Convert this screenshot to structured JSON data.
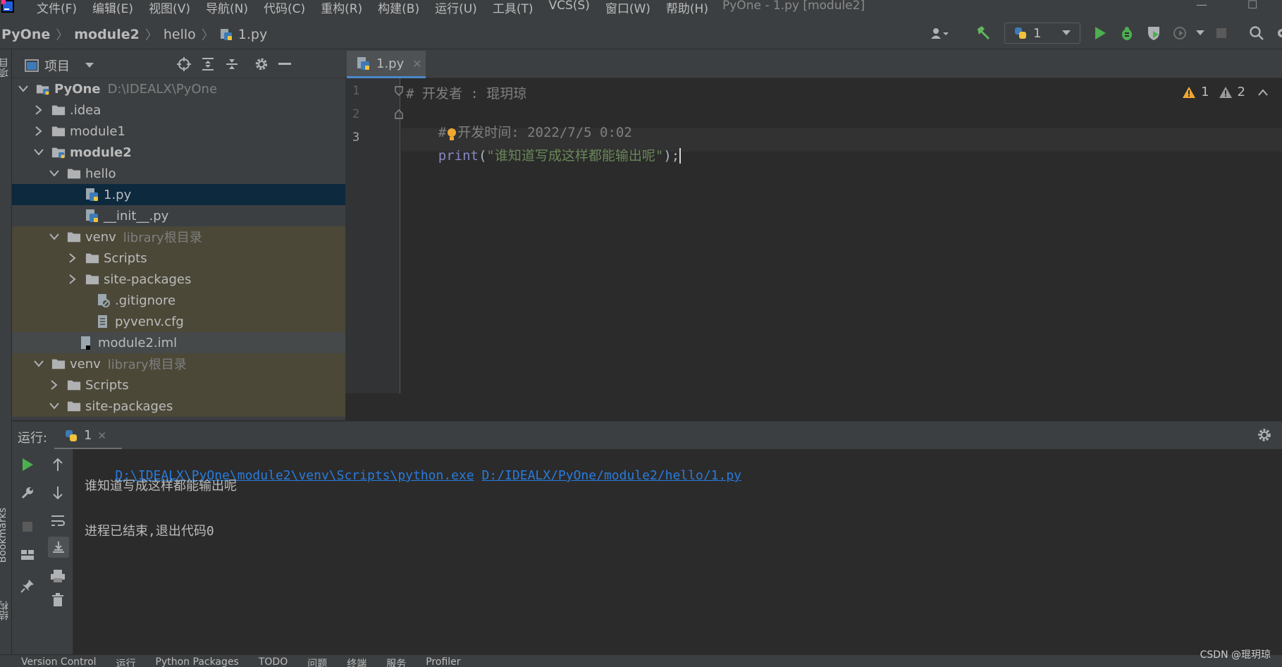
{
  "menubar": {
    "items": [
      "文件(F)",
      "编辑(E)",
      "视图(V)",
      "导航(N)",
      "代码(C)",
      "重构(R)",
      "构建(B)",
      "运行(U)",
      "工具(T)",
      "VCS(S)",
      "窗口(W)",
      "帮助(H)"
    ],
    "window_title": "PyOne - 1.py [module2]"
  },
  "navbar": {
    "crumbs": [
      "PyOne",
      "module2",
      "hello",
      "1.py"
    ],
    "run_config_label": "1"
  },
  "left_strip": {
    "top_label": "项目",
    "bookmarks_label": "Bookmarks",
    "structure_label": "结构"
  },
  "project_panel": {
    "title": "项目",
    "tree": [
      {
        "name": "PyOne",
        "hint": "D:\\IDEALX\\PyOne"
      },
      {
        "name": ".idea"
      },
      {
        "name": "module1"
      },
      {
        "name": "module2"
      },
      {
        "name": "hello"
      },
      {
        "name": "1.py"
      },
      {
        "name": "__init__.py"
      },
      {
        "name": "venv",
        "hint": "library根目录"
      },
      {
        "name": "Scripts"
      },
      {
        "name": "site-packages"
      },
      {
        "name": ".gitignore"
      },
      {
        "name": "pyvenv.cfg"
      },
      {
        "name": "module2.iml"
      },
      {
        "name": "venv",
        "hint": "library根目录"
      },
      {
        "name": "Scripts"
      },
      {
        "name": "site-packages"
      }
    ]
  },
  "editor": {
    "tab_label": "1.py",
    "line_numbers": [
      "1",
      "2",
      "3"
    ],
    "lines": {
      "l1": "# 开发者 : 琨玥琼",
      "l2a": "#",
      "l2b": "开发时间: 2022/7/5 0:02",
      "l3_kw": "print",
      "l3_open": "(",
      "l3_str": "\"谁知道写成这样都能输出呢\"",
      "l3_close": ");"
    },
    "inspections": {
      "warnings": "1",
      "weak_warnings": "2"
    }
  },
  "run_panel": {
    "label": "运行:",
    "tab_label": "1",
    "console": {
      "exe_path": "D:\\IDEALX\\PyOne\\module2\\venv\\Scripts\\python.exe",
      "script_path": "D:/IDEALX/PyOne/module2/hello/1.py",
      "output": "谁知道写成这样都能输出呢",
      "exit_msg": "进程已结束,退出代码0"
    }
  },
  "statusbar": {
    "items": [
      "Version Control",
      "运行",
      "Python Packages",
      "TODO",
      "问题",
      "终端",
      "服务",
      "Profiler"
    ]
  },
  "watermark": "CSDN @琨玥琼",
  "colors": {
    "background": "#2b2b2b",
    "panel": "#3c3f41",
    "selection": "#0d293e",
    "library_bg": "#4b4838",
    "link": "#287bde",
    "string": "#6a8759",
    "run_green": "#4caf50",
    "warning": "#f0a732"
  }
}
